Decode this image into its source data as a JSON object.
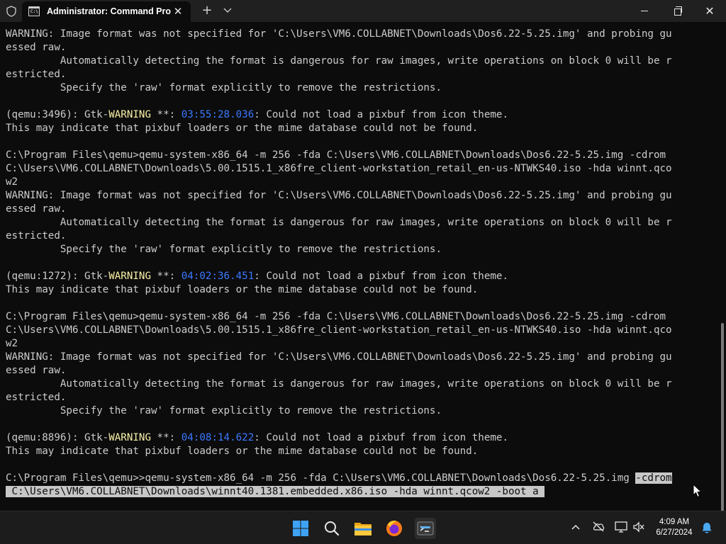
{
  "window": {
    "tab_title": "Administrator: Command Pro",
    "tab_icon_glyph": "C:\\"
  },
  "terminal": {
    "lines": [
      [
        {
          "t": "WARNING: Image format was not specified for 'C:\\Users\\VM6.COLLABNET\\Downloads\\Dos6.22-5.25.img' and probing gu"
        }
      ],
      [
        {
          "t": "essed raw."
        }
      ],
      [
        {
          "t": "         Automatically detecting the format is dangerous for raw images, write operations on block 0 will be r"
        }
      ],
      [
        {
          "t": "estricted."
        }
      ],
      [
        {
          "t": "         Specify the 'raw' format explicitly to remove the restrictions."
        }
      ],
      [
        {
          "t": ""
        }
      ],
      [
        {
          "t": "(qemu:3496): Gtk-"
        },
        {
          "t": "WARNING",
          "c": "warn"
        },
        {
          "t": " **: "
        },
        {
          "t": "03:55:28.036",
          "c": "ts"
        },
        {
          "t": ": Could not load a pixbuf from icon theme."
        }
      ],
      [
        {
          "t": "This may indicate that pixbuf loaders or the mime database could not be found."
        }
      ],
      [
        {
          "t": ""
        }
      ],
      [
        {
          "t": "C:\\Program Files\\qemu>qemu-system-x86_64 -m 256 -fda C:\\Users\\VM6.COLLABNET\\Downloads\\Dos6.22-5.25.img -cdrom"
        }
      ],
      [
        {
          "t": "C:\\Users\\VM6.COLLABNET\\Downloads\\5.00.1515.1_x86fre_client-workstation_retail_en-us-NTWKS40.iso -hda winnt.qco"
        }
      ],
      [
        {
          "t": "w2"
        }
      ],
      [
        {
          "t": "WARNING: Image format was not specified for 'C:\\Users\\VM6.COLLABNET\\Downloads\\Dos6.22-5.25.img' and probing gu"
        }
      ],
      [
        {
          "t": "essed raw."
        }
      ],
      [
        {
          "t": "         Automatically detecting the format is dangerous for raw images, write operations on block 0 will be r"
        }
      ],
      [
        {
          "t": "estricted."
        }
      ],
      [
        {
          "t": "         Specify the 'raw' format explicitly to remove the restrictions."
        }
      ],
      [
        {
          "t": ""
        }
      ],
      [
        {
          "t": "(qemu:1272): Gtk-"
        },
        {
          "t": "WARNING",
          "c": "warn"
        },
        {
          "t": " **: "
        },
        {
          "t": "04:02:36.451",
          "c": "ts"
        },
        {
          "t": ": Could not load a pixbuf from icon theme."
        }
      ],
      [
        {
          "t": "This may indicate that pixbuf loaders or the mime database could not be found."
        }
      ],
      [
        {
          "t": ""
        }
      ],
      [
        {
          "t": "C:\\Program Files\\qemu>qemu-system-x86_64 -m 256 -fda C:\\Users\\VM6.COLLABNET\\Downloads\\Dos6.22-5.25.img -cdrom"
        }
      ],
      [
        {
          "t": "C:\\Users\\VM6.COLLABNET\\Downloads\\5.00.1515.1_x86fre_client-workstation_retail_en-us-NTWKS40.iso -hda winnt.qco"
        }
      ],
      [
        {
          "t": "w2"
        }
      ],
      [
        {
          "t": "WARNING: Image format was not specified for 'C:\\Users\\VM6.COLLABNET\\Downloads\\Dos6.22-5.25.img' and probing gu"
        }
      ],
      [
        {
          "t": "essed raw."
        }
      ],
      [
        {
          "t": "         Automatically detecting the format is dangerous for raw images, write operations on block 0 will be r"
        }
      ],
      [
        {
          "t": "estricted."
        }
      ],
      [
        {
          "t": "         Specify the 'raw' format explicitly to remove the restrictions."
        }
      ],
      [
        {
          "t": ""
        }
      ],
      [
        {
          "t": "(qemu:8896): Gtk-"
        },
        {
          "t": "WARNING",
          "c": "warn"
        },
        {
          "t": " **: "
        },
        {
          "t": "04:08:14.622",
          "c": "ts"
        },
        {
          "t": ": Could not load a pixbuf from icon theme."
        }
      ],
      [
        {
          "t": "This may indicate that pixbuf loaders or the mime database could not be found."
        }
      ],
      [
        {
          "t": ""
        }
      ],
      [
        {
          "t": "C:\\Program Files\\qemu>>qemu-system-x86_64 -m 256 -fda C:\\Users\\VM6.COLLABNET\\Downloads\\Dos6.22-5.25.img "
        },
        {
          "t": "-cdrom",
          "c": "sel"
        }
      ],
      [
        {
          "t": " C:\\Users\\VM6.COLLABNET\\Downloads\\winnt40.1381.embedded.x86.iso -hda winnt.qcow2 -boot a ",
          "c": "sel"
        }
      ]
    ]
  },
  "taskbar": {
    "apps": [
      "start-button",
      "search-button",
      "file-explorer",
      "firefox",
      "terminal"
    ],
    "clock_time": "4:09 AM",
    "clock_date": "6/27/2024"
  },
  "colors": {
    "terminal_bg": "#0c0c0c",
    "terminal_fg": "#cccccc",
    "warning_yellow": "#f9f1a5",
    "timestamp_blue": "#3b78ff",
    "selection": "#c7c7c7",
    "titlebar_bg": "#202020",
    "taskbar_bg": "#1c1c1c"
  }
}
